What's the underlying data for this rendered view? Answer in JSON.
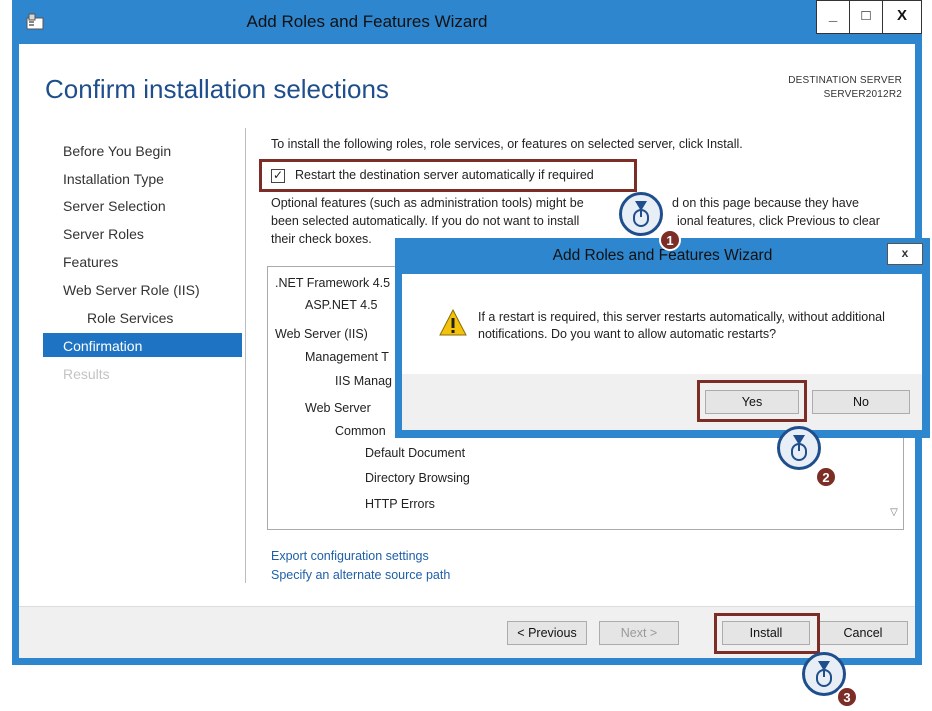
{
  "window": {
    "title": "Add Roles and Features Wizard",
    "minimize": "_",
    "maximize": "□",
    "close": "X"
  },
  "page": {
    "heading": "Confirm installation selections",
    "destination_label": "DESTINATION SERVER",
    "destination_name": "SERVER2012R2"
  },
  "nav": [
    {
      "label": "Before You Begin"
    },
    {
      "label": "Installation Type"
    },
    {
      "label": "Server Selection"
    },
    {
      "label": "Server Roles"
    },
    {
      "label": "Features"
    },
    {
      "label": "Web Server Role (IIS)"
    },
    {
      "label": "Role Services"
    },
    {
      "label": "Confirmation"
    },
    {
      "label": "Results"
    }
  ],
  "main": {
    "intro": "To install the following roles, role services, or features on selected server, click Install.",
    "restart_checkbox_label": "Restart the destination server automatically if required",
    "restart_checked": true,
    "optional_line1": "Optional features (such as administration tools) might be",
    "optional_line1b": "d on this page because they have",
    "optional_line2": "been selected automatically. If you do not want to install",
    "optional_line2b": "ional features, click Previous to clear",
    "optional_line3": "their check boxes.",
    "items": [
      ".NET Framework 4.5",
      "ASP.NET 4.5",
      "Web Server (IIS)",
      "Management T",
      "IIS Manag",
      "Web Server",
      "Common",
      "Default Document",
      "Directory Browsing",
      "HTTP Errors"
    ],
    "export_link": "Export configuration settings",
    "source_link": "Specify an alternate source path"
  },
  "footer": {
    "previous": "< Previous",
    "next": "Next >",
    "install": "Install",
    "cancel": "Cancel"
  },
  "dialog": {
    "title": "Add Roles and Features Wizard",
    "close": "x",
    "message": "If a restart is required, this server restarts automatically, without additional notifications. Do you want to allow automatic restarts?",
    "yes": "Yes",
    "no": "No"
  },
  "steps": [
    "1",
    "2",
    "3"
  ],
  "colors": {
    "accent": "#2e86cf",
    "heading": "#1f4e8c",
    "nav_selected": "#1e74c2",
    "highlight": "#7b2d26",
    "link": "#1f5fa8"
  }
}
